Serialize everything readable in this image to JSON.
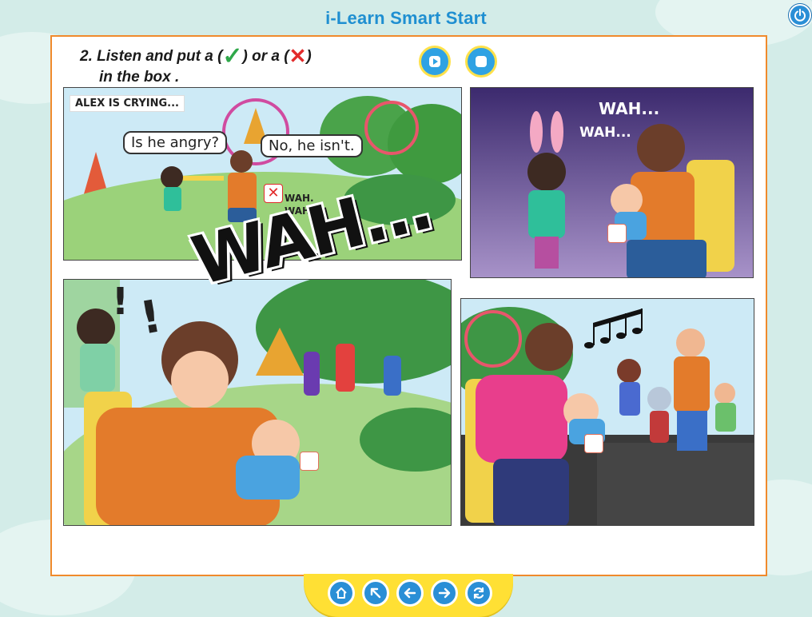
{
  "app": {
    "title": "i-Learn Smart Start"
  },
  "exercise": {
    "instruction_line1_a": "2. Listen and put a (",
    "instruction_line1_b": ") or a (",
    "instruction_line1_c": ")",
    "instruction_line2": "in the box .",
    "check_glyph": "✓",
    "cross_glyph": "✕"
  },
  "audio_controls": {
    "play_icon": "play-icon",
    "stop_icon": "stop-icon"
  },
  "panels": {
    "p1": {
      "caption": "ALEX IS CRYING...",
      "bubble_girl": "Is he angry?",
      "bubble_man": "No, he isn't.",
      "sfx": [
        "WAH.",
        "WAH..."
      ],
      "answer_mark": "✕"
    },
    "p2": {
      "sfx": [
        "WAH...",
        "WAH..."
      ]
    },
    "big_sfx": "WAH..."
  },
  "nav": {
    "buttons": [
      "home-icon",
      "arrow-up-left-icon",
      "arrow-left-icon",
      "arrow-right-icon",
      "refresh-icon"
    ]
  },
  "colors": {
    "background": "#d3ece8",
    "accent_blue": "#2a8fd6",
    "frame_orange": "#f08a2c",
    "nav_yellow": "#ffe034",
    "check_green": "#2fa84a",
    "cross_red": "#e22b2b"
  }
}
